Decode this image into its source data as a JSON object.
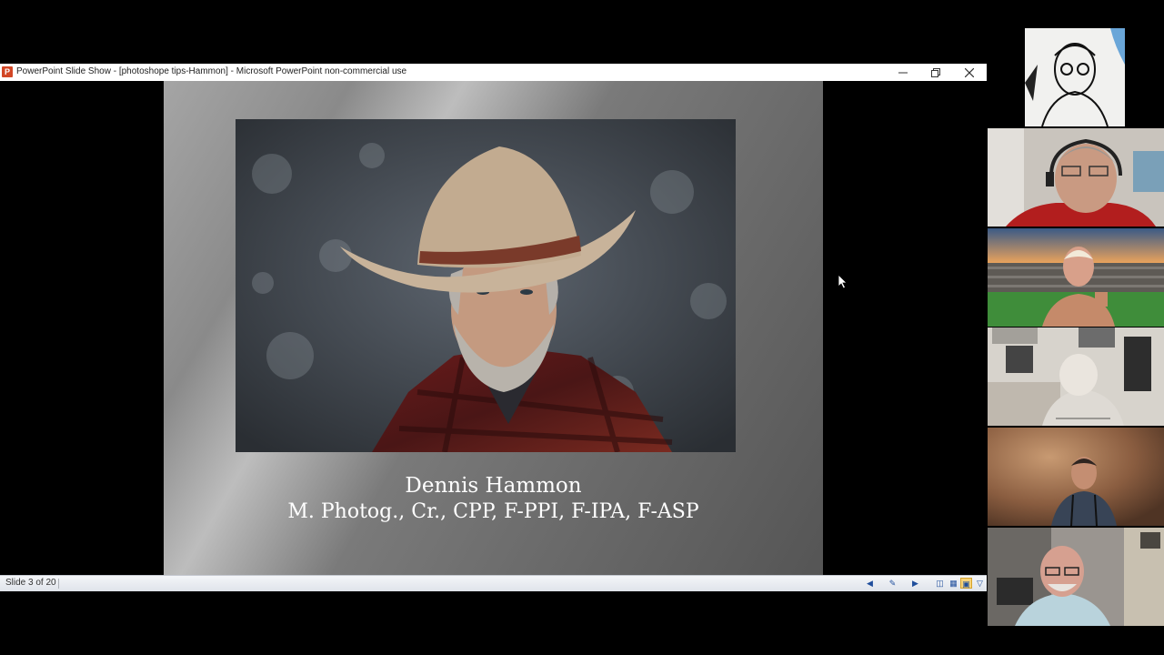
{
  "window": {
    "app_icon": "P",
    "title": "PowerPoint Slide Show - [photoshope tips-Hammon] - Microsoft PowerPoint non-commercial use",
    "controls": {
      "minimize": "minimize-icon",
      "restore": "restore-icon",
      "close": "close-icon"
    }
  },
  "slide": {
    "name": "Dennis Hammon",
    "credentials": "M. Photog., Cr., CPP, F-PPI, F-IPA, F-ASP"
  },
  "statusbar": {
    "slide_counter": "Slide 3 of 20",
    "buttons": [
      "previous-slide-icon",
      "notes-icon",
      "next-slide-icon",
      "normal-view-icon",
      "slide-sorter-icon",
      "reading-view-icon",
      "slide-show-icon"
    ]
  },
  "participants": [
    {
      "name": "participant-1",
      "tile": "sketch-portrait"
    },
    {
      "name": "participant-2",
      "tile": "headset"
    },
    {
      "name": "participant-3",
      "tile": "stadium-background"
    },
    {
      "name": "participant-4",
      "tile": "office"
    },
    {
      "name": "participant-5",
      "tile": "mottled-backdrop"
    },
    {
      "name": "participant-6",
      "tile": "studio"
    }
  ],
  "colors": {
    "accent_orange": "#d24726",
    "slide_text": "#ffffff"
  }
}
